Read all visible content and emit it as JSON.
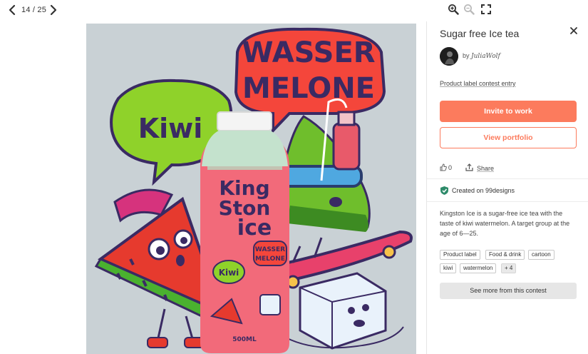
{
  "viewer": {
    "counter": "14 / 25",
    "icons": {
      "prev": "chevron-left-icon",
      "next": "chevron-right-icon",
      "zoom_in": "zoom-in-icon",
      "zoom_out": "zoom-out-icon",
      "fullscreen": "fullscreen-icon"
    }
  },
  "artwork": {
    "bubble_top": [
      "WASSER",
      "MELONE"
    ],
    "bubble_left": "Kiwi",
    "bottle_label": [
      "King",
      "Ston",
      "ice"
    ],
    "bottle_small_bubble": [
      "WASSER",
      "MELONE"
    ],
    "bottle_kiwi": "Kiwi",
    "bottle_volume": "500ML",
    "colors": {
      "background": "#c9d1d5",
      "bottle": "#f26a7a",
      "bubble_red": "#f4463b",
      "bubble_green": "#8fd22a",
      "lettering": "#3a2a63"
    }
  },
  "panel": {
    "title": "Sugar free Ice tea",
    "by_prefix": "by",
    "author": "JuliaWolf",
    "contest_link": "Product label contest entry",
    "invite_button": "Invite to work",
    "portfolio_button": "View portfolio",
    "likes": "0",
    "share": "Share",
    "created": "Created on 99designs",
    "description": "Kingston Ice is a sugar-free ice tea with the taste of kiwi watermelon. A target group at the age of 6—25.",
    "tags": [
      "Product label",
      "Food & drink",
      "cartoon",
      "kiwi",
      "watermelon",
      "+ 4"
    ],
    "see_more": "See more from this contest",
    "colors": {
      "accent": "#fc7b5d",
      "verified": "#2e8b6a"
    }
  }
}
